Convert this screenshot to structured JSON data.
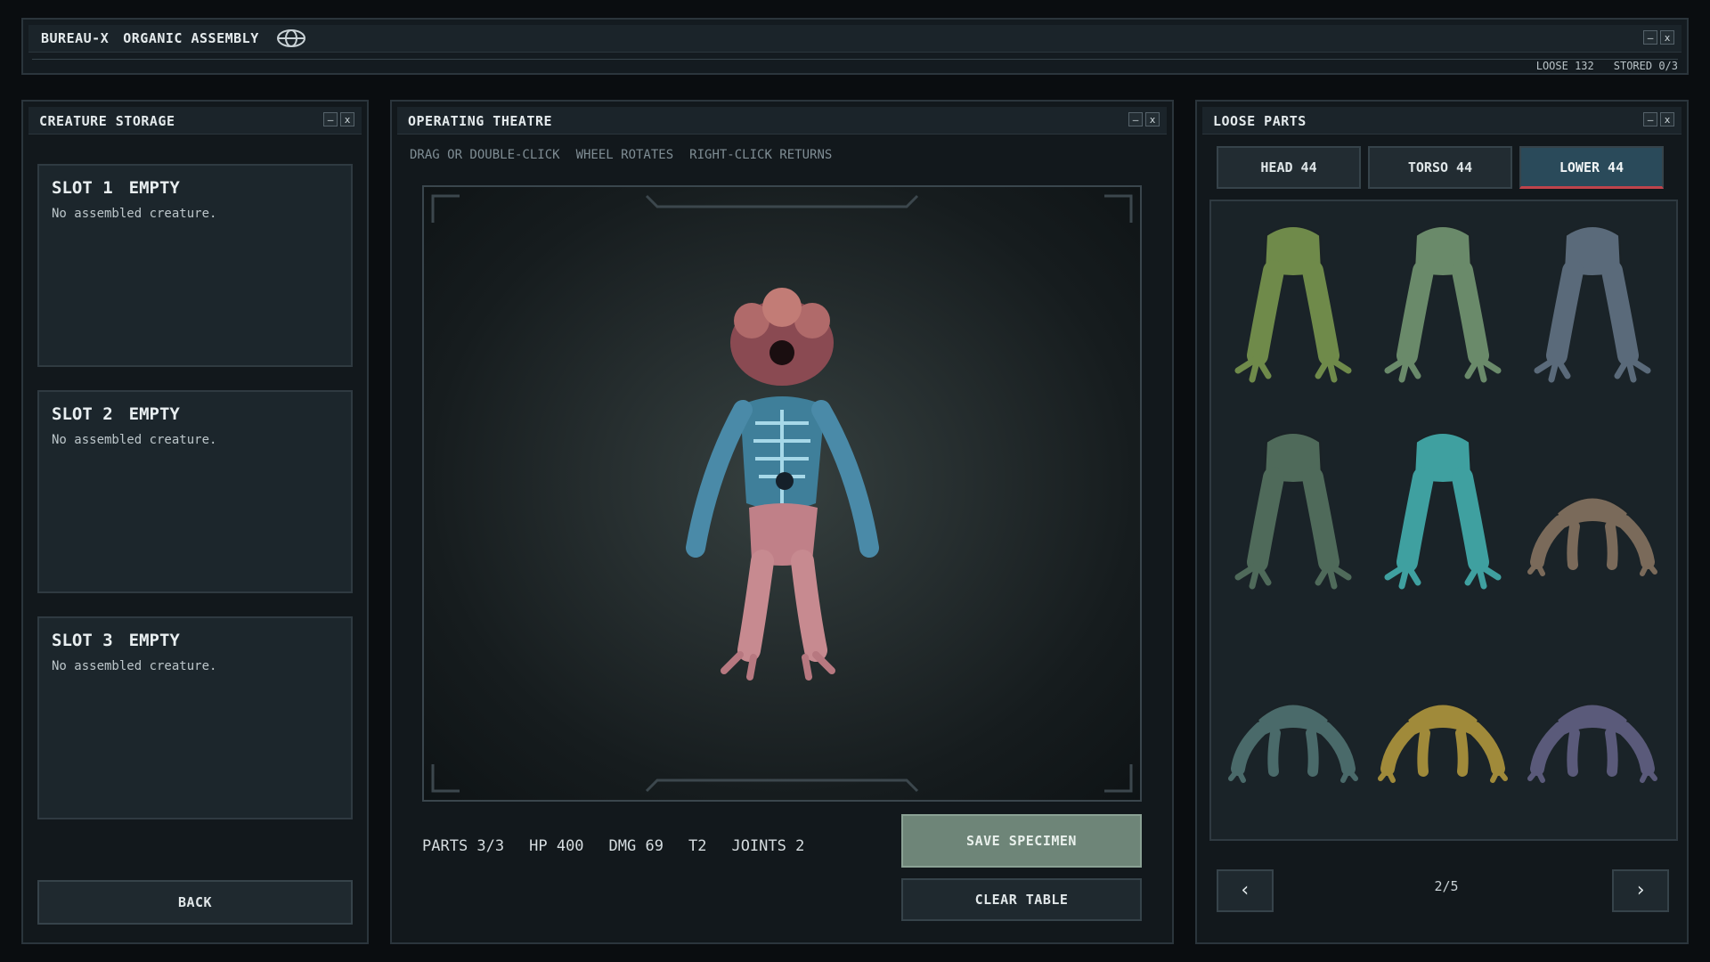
{
  "app": {
    "title_parts": [
      "BUREAU-X",
      "ORGANIC ASSEMBLY"
    ],
    "status": [
      "LOOSE 132",
      "STORED 0/3"
    ]
  },
  "window_buttons": {
    "minimize": "–",
    "close": "x"
  },
  "storage": {
    "title": "CREATURE STORAGE",
    "slots": [
      {
        "label": "SLOT 1",
        "state": "EMPTY",
        "desc": "No assembled creature."
      },
      {
        "label": "SLOT 2",
        "state": "EMPTY",
        "desc": "No assembled creature."
      },
      {
        "label": "SLOT 3",
        "state": "EMPTY",
        "desc": "No assembled creature."
      }
    ],
    "back_label": "BACK"
  },
  "theatre": {
    "title": "OPERATING THEATRE",
    "hints": [
      "DRAG OR DOUBLE-CLICK",
      "WHEEL ROTATES",
      "RIGHT-CLICK RETURNS"
    ],
    "stats": [
      "PARTS 3/3",
      "HP 400",
      "DMG 69",
      "T2",
      "JOINTS 2"
    ],
    "save_label": "SAVE SPECIMEN",
    "clear_label": "CLEAR TABLE"
  },
  "parts": {
    "title": "LOOSE PARTS",
    "tabs": [
      {
        "label": "HEAD 44",
        "active": false
      },
      {
        "label": "TORSO 44",
        "active": false
      },
      {
        "label": "LOWER 44",
        "active": true
      }
    ],
    "items": [
      {
        "type": "legs-icon",
        "color": "#6f8a4a"
      },
      {
        "type": "legs-icon",
        "color": "#6a8a6a"
      },
      {
        "type": "legs-icon",
        "color": "#5a6a7a"
      },
      {
        "type": "legs-icon",
        "color": "#4f6a5a"
      },
      {
        "type": "legs-icon",
        "color": "#3fa0a0"
      },
      {
        "type": "crab-legs-icon",
        "color": "#7a6a5a"
      },
      {
        "type": "crab-legs-icon",
        "color": "#4a6a6a"
      },
      {
        "type": "crab-legs-icon",
        "color": "#a08a3a"
      },
      {
        "type": "crab-legs-icon",
        "color": "#5a5a7a"
      }
    ],
    "page": "2/5",
    "prev": "‹",
    "next": "›"
  }
}
